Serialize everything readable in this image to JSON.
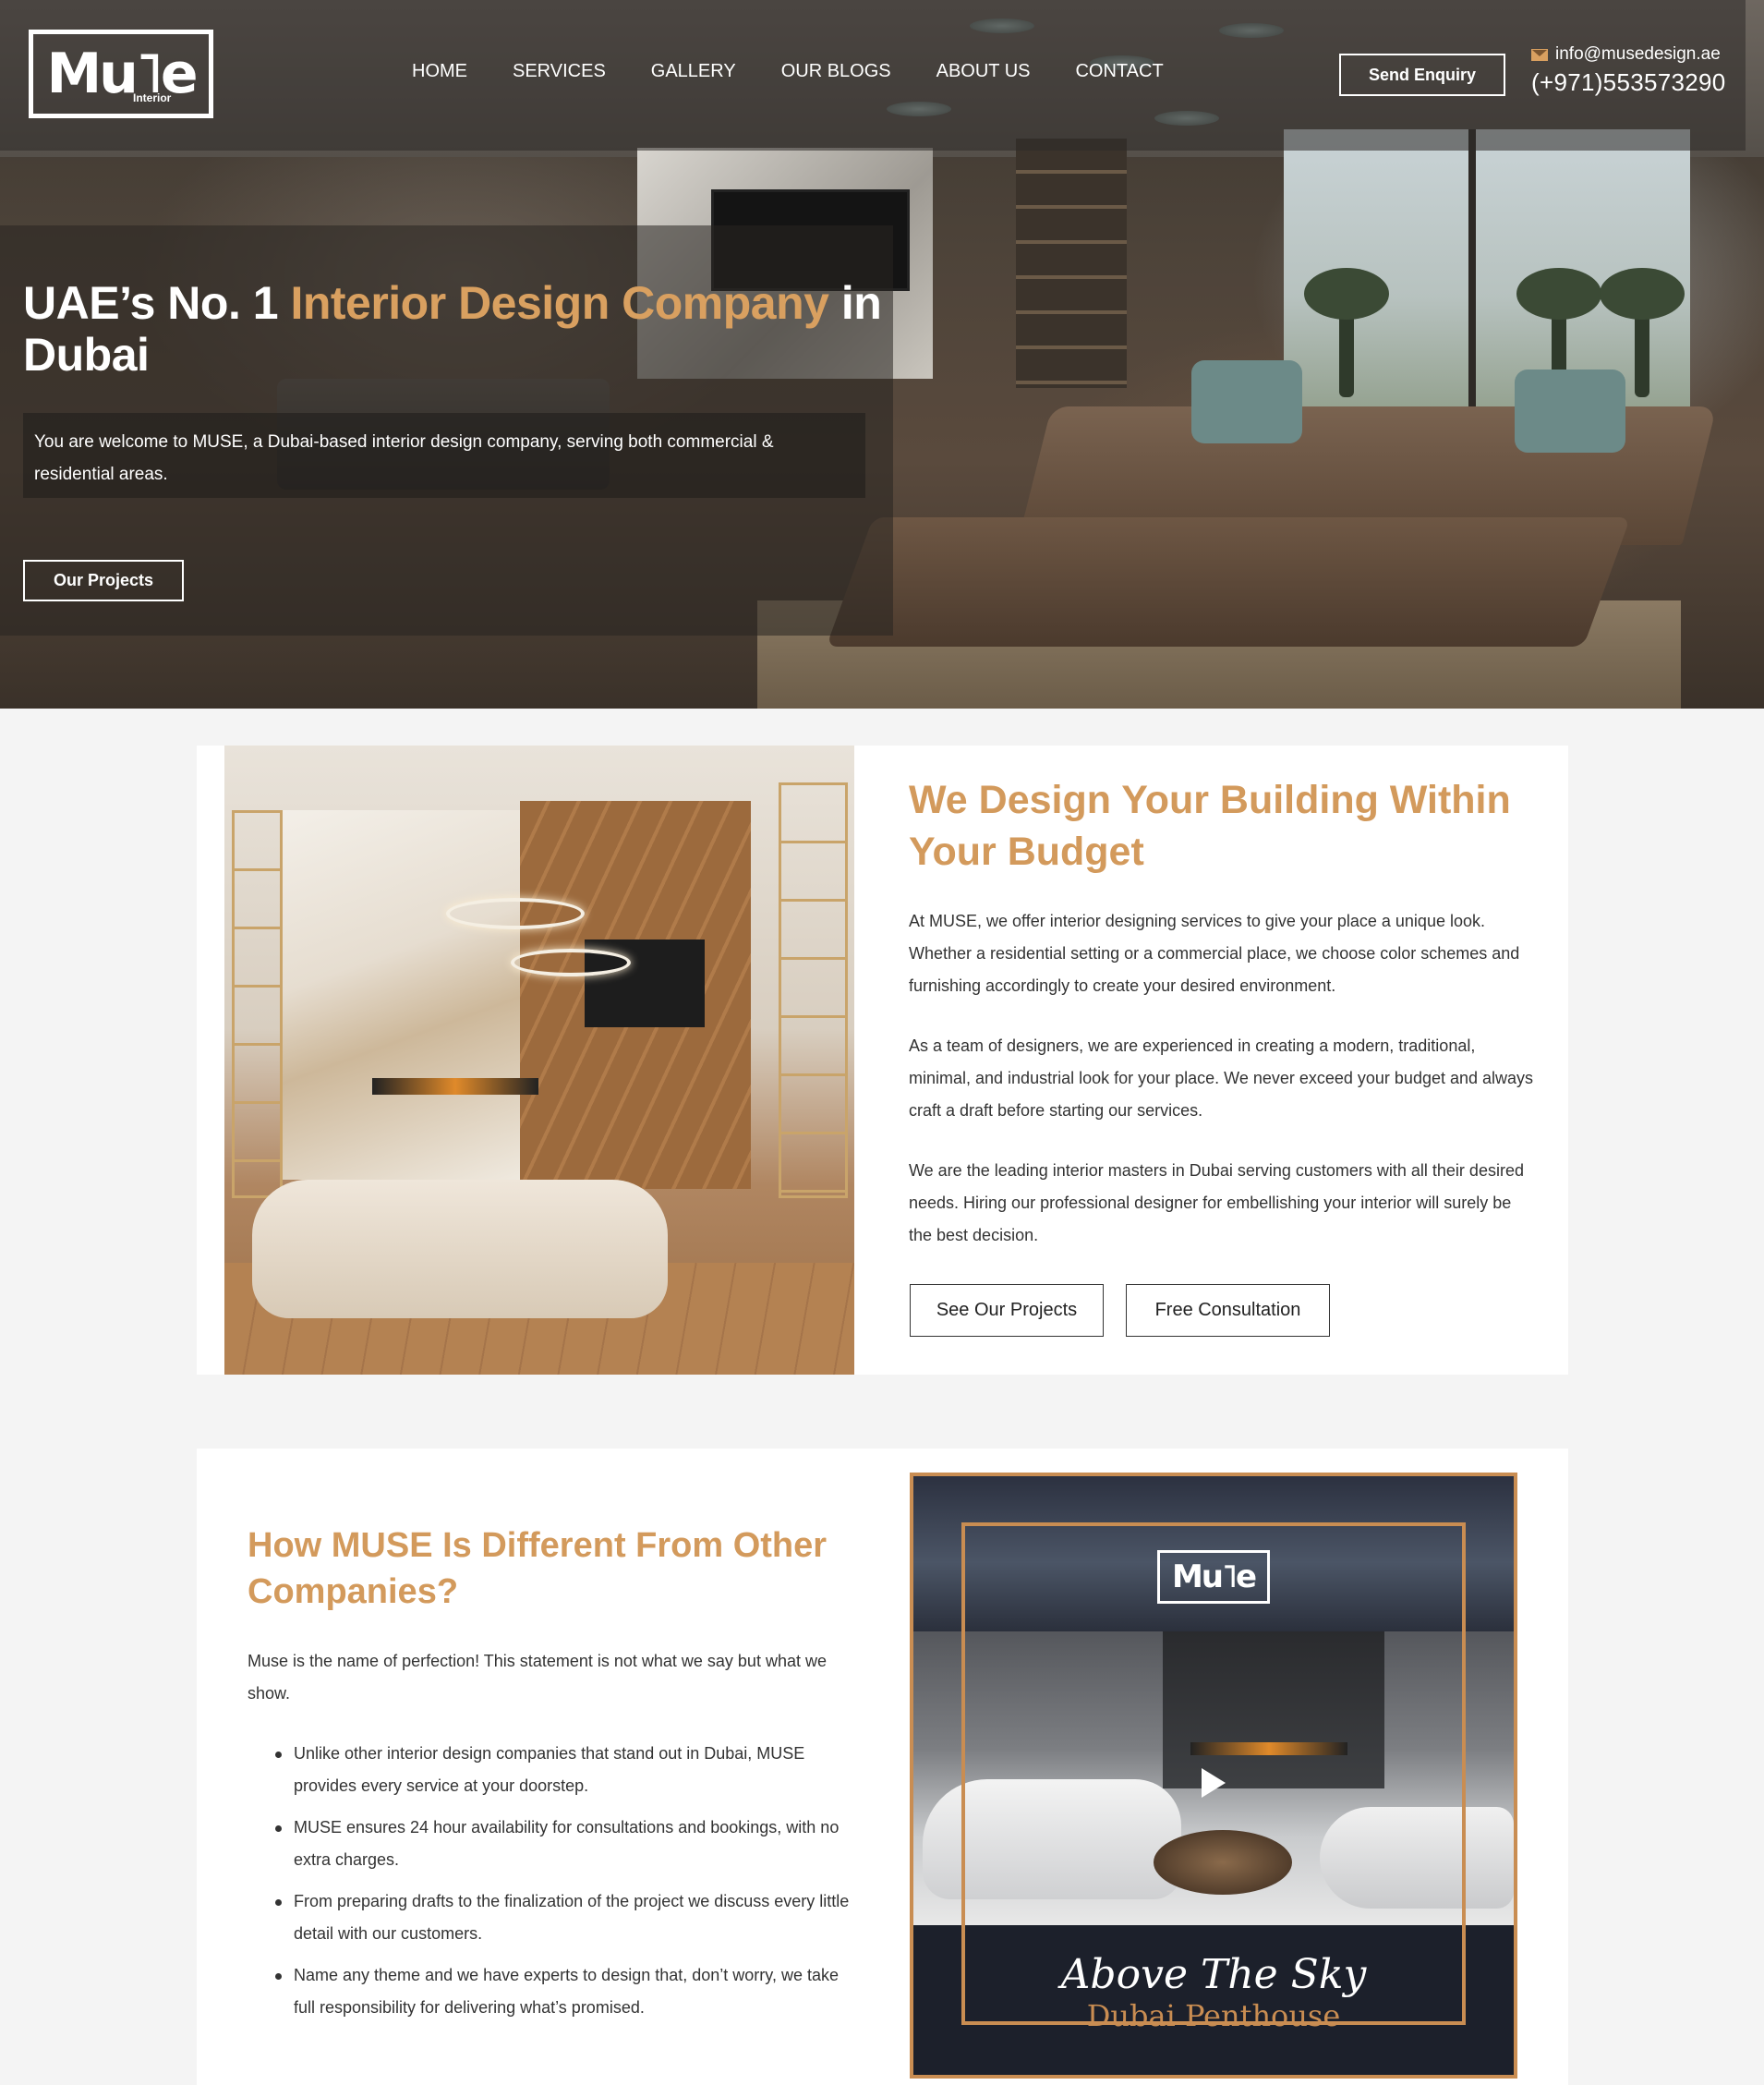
{
  "header": {
    "logo_text": "Mu˥e",
    "logo_sub": "Interior",
    "nav": [
      "HOME",
      "SERVICES",
      "GALLERY",
      "OUR BLOGS",
      "ABOUT US",
      "CONTACT"
    ],
    "send_enquiry": "Send Enquiry",
    "email": "info@musedesign.ae",
    "phone": "(+971)553573290"
  },
  "hero": {
    "title_part1": "UAE’s No. 1 ",
    "title_accent": "Interior Design Company",
    "title_part2": " in Dubai",
    "subtitle": "You are welcome to MUSE, a Dubai-based interior design company, serving both commercial & residential areas.",
    "cta": "Our Projects"
  },
  "section1": {
    "title": "We Design Your Building Within Your Budget",
    "paragraphs": [
      "At MUSE, we offer interior designing services to give your place a unique look. Whether a residential setting or a commercial place, we choose color schemes and furnishing accordingly to create your desired environment.",
      "As a team of designers, we are experienced in creating a modern, traditional, minimal, and industrial look for your place. We never exceed your budget and always craft a draft before starting our services.",
      "We are the leading interior masters in Dubai serving customers with all their desired needs. Hiring our professional designer for embellishing your interior will surely be the best decision."
    ],
    "btn_projects": "See Our Projects",
    "btn_consult": "Free Consultation"
  },
  "section2": {
    "title": "How MUSE Is Different From Other Companies?",
    "intro": "Muse is the name of perfection! This statement is not what we say but what we show.",
    "bullets": [
      "Unlike other interior design companies that stand out in Dubai, MUSE provides every service at your doorstep.",
      "MUSE ensures 24 hour availability for consultations and bookings, with no extra charges.",
      "From preparing drafts to the finalization of the project we discuss every little detail with our customers.",
      "Name any theme and we have experts to design that, don’t worry, we take full responsibility for delivering what’s promised."
    ],
    "video": {
      "logo_text": "Mu˥e",
      "title": "Above The Sky",
      "subtitle": "Dubai Penthouse"
    }
  },
  "colors": {
    "accent": "#d39a5c",
    "hero_accent": "#d9a060",
    "video_border": "#c98d52"
  },
  "icons": [
    "mail-icon",
    "play-icon"
  ]
}
